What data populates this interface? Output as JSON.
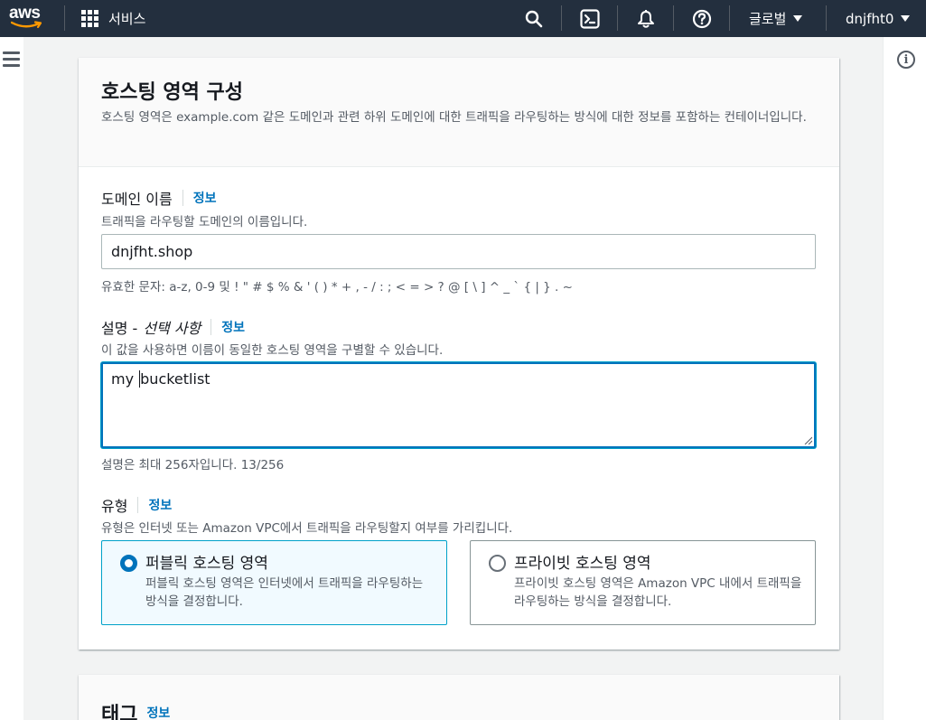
{
  "topnav": {
    "logo": "aws",
    "services_label": "서비스",
    "region_label": "글로벌",
    "account_label": "dnjfht0",
    "icons": [
      "search-icon",
      "cloudshell-icon",
      "bell-icon",
      "help-icon"
    ],
    "bg_color": "#232f3e"
  },
  "panel": {
    "title": "호스팅 영역 구성",
    "description": "호스팅 영역은 example.com 같은 도메인과 관련 하위 도메인에 대한 트래픽을 라우팅하는 방식에 대한 정보를 포함하는 컨테이너입니다.",
    "domain": {
      "label": "도메인 이름",
      "info": "정보",
      "description": "트래픽을 라우팅할 도메인의 이름입니다.",
      "value": "dnjfht.shop",
      "constraint": "유효한 문자: a-z, 0-9 및 ! \" # $ % & ' ( ) * + , - / : ; < = > ? @ [ \\ ] ^ _ ` { | } . ~"
    },
    "comment": {
      "label_main": "설명 - ",
      "label_optional": "선택 사항",
      "info": "정보",
      "description": "이 값을 사용하면 이름이 동일한 호스팅 영역을 구별할 수 있습니다.",
      "value_before_caret": "my ",
      "value_after_caret": "bucketlist",
      "constraint": "설명은 최대 256자입니다. 13/256"
    },
    "type": {
      "label": "유형",
      "info": "정보",
      "description": "유형은 인터넷 또는 Amazon VPC에서 트래픽을 라우팅할지 여부를 가리킵니다.",
      "options": [
        {
          "title": "퍼블릭 호스팅 영역",
          "description": "퍼블릭 호스팅 영역은 인터넷에서 트래픽을 라우팅하는 방식을 결정합니다.",
          "selected": true
        },
        {
          "title": "프라이빗 호스팅 영역",
          "description": "프라이빗 호스팅 영역은 Amazon VPC 내에서 트래픽을 라우팅하는 방식을 결정합니다.",
          "selected": false
        }
      ]
    }
  },
  "tags_panel": {
    "title": "태그",
    "info": "정보"
  },
  "colors": {
    "accent": "#0073bb",
    "selected_bg": "#f1faff",
    "focus": "#00a1c9"
  }
}
